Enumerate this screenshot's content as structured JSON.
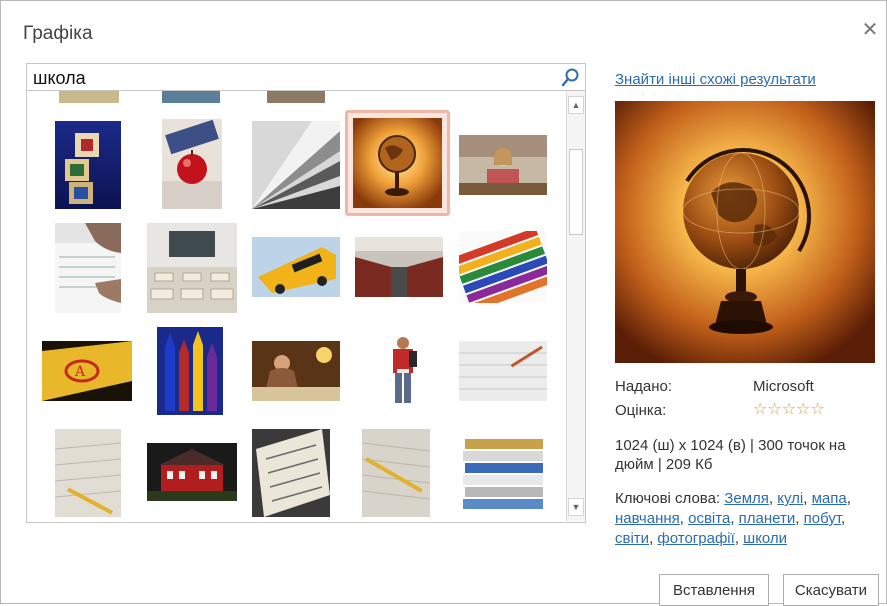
{
  "dialog": {
    "title": "Графіка",
    "close_glyph": "✕"
  },
  "search": {
    "value": "школа",
    "button_icon": "search-icon"
  },
  "results": {
    "selected_index": 3,
    "thumbnails": [
      {
        "name": "letter-blocks",
        "subject": "alphabet blocks"
      },
      {
        "name": "apple-on-books",
        "subject": "red apple on books"
      },
      {
        "name": "book-pages",
        "subject": "fanned book pages"
      },
      {
        "name": "globe",
        "subject": "globe"
      },
      {
        "name": "girl-at-desk",
        "subject": "girl at school desk"
      },
      {
        "name": "hands-writing",
        "subject": "hands writing"
      },
      {
        "name": "empty-classroom",
        "subject": "empty classroom"
      },
      {
        "name": "school-bus",
        "subject": "school bus"
      },
      {
        "name": "bus-interior",
        "subject": "bus interior seats"
      },
      {
        "name": "crayons",
        "subject": "crayons"
      },
      {
        "name": "graded-test",
        "subject": "graded test paper"
      },
      {
        "name": "crayons-closeup",
        "subject": "crayons close-up"
      },
      {
        "name": "student-studying",
        "subject": "student studying"
      },
      {
        "name": "student-backpack",
        "subject": "student with backpack"
      },
      {
        "name": "pencil-notebook",
        "subject": "pencil on notebook"
      },
      {
        "name": "pencil-paper",
        "subject": "pencil on paper"
      },
      {
        "name": "schoolhouse",
        "subject": "red schoolhouse"
      },
      {
        "name": "test-sheet",
        "subject": "test sheet"
      },
      {
        "name": "notebook-pencil",
        "subject": "notebook with pencil"
      },
      {
        "name": "binders-stack",
        "subject": "stack of binders"
      }
    ]
  },
  "side": {
    "more_link": "Знайти інші схожі результати",
    "provided_label": "Надано:",
    "provided_value": "Microsoft",
    "rating_label": "Оцінка:",
    "rating_stars": "☆☆☆☆☆",
    "rating_value": 0,
    "details": "1024 (ш) x 1024 (в) | 300 точок на дюйм | 209 Кб",
    "keywords_label": "Ключові слова:",
    "keywords": [
      "Земля",
      "кулі",
      "мапа",
      "навчання",
      "освіта",
      "планети",
      "побут",
      "світи",
      "фотографії",
      "школи"
    ]
  },
  "buttons": {
    "insert": "Вставлення",
    "cancel": "Скасувати"
  },
  "colors": {
    "link": "#2b6cb0",
    "selection_border": "#f0b7a8",
    "star": "#d79a3b"
  }
}
